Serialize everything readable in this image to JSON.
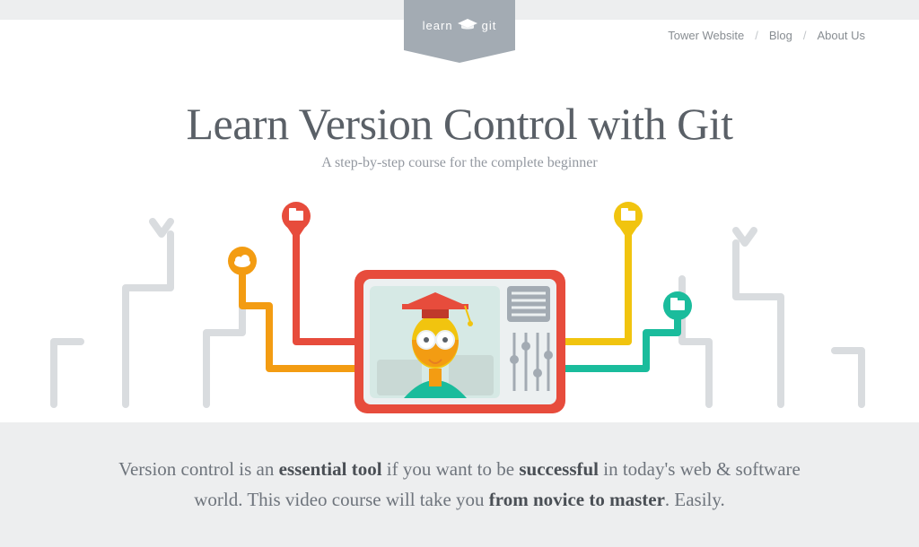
{
  "brand": {
    "word_left": "learn",
    "word_right": "git"
  },
  "nav": {
    "items": [
      "Tower Website",
      "Blog",
      "About Us"
    ],
    "separator": "/"
  },
  "hero": {
    "title": "Learn Version Control with Git",
    "subtitle": "A step-by-step course for the complete beginner"
  },
  "intro": {
    "t1": "Version control is an ",
    "b1": "essential tool",
    "t2": " if you want to be ",
    "b2": "successful",
    "t3": " in today's web & software world. This video course will take you ",
    "b3": "from novice to master",
    "t4": ". Easily."
  },
  "colors": {
    "red": "#e74c3c",
    "orange": "#f39c12",
    "yellow": "#f1c40f",
    "teal": "#1abc9c",
    "gray": "#d9dcdf",
    "darkgray": "#a3abb3"
  }
}
